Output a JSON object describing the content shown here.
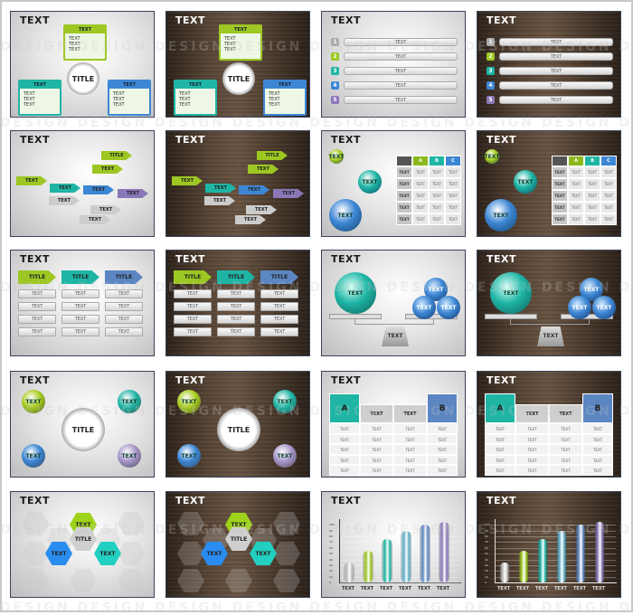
{
  "watermark": "DESIGN DESIGN DESIGN DESIGN DESIGN DESIGN DESIGN DESIGN DESIGN",
  "colors": {
    "green": "#9dc722",
    "teal": "#1fb5a5",
    "blue": "#3d86d4",
    "steel_blue": "#5b86c2",
    "purple": "#8a77b8",
    "grey": "#bdbdbd",
    "frame_border": "#3a4256"
  },
  "thumbnails": [
    {
      "id": 1,
      "theme": "light",
      "heading": "TEXT",
      "type": "three-box-hub",
      "center": "TITLE",
      "boxes": [
        {
          "label": "TEXT",
          "bullets": [
            "TEXT",
            "TEXT",
            "TEXT"
          ]
        },
        {
          "label": "TEXT",
          "bullets": [
            "TEXT",
            "TEXT",
            "TEXT"
          ]
        },
        {
          "label": "TEXT",
          "bullets": [
            "TEXT",
            "TEXT",
            "TEXT"
          ]
        }
      ]
    },
    {
      "id": 2,
      "theme": "dark",
      "heading": "TEXT",
      "type": "three-box-hub",
      "center": "TITLE",
      "boxes": [
        {
          "label": "TEXT",
          "bullets": [
            "TEXT",
            "TEXT",
            "TEXT"
          ]
        },
        {
          "label": "TEXT",
          "bullets": [
            "TEXT",
            "TEXT",
            "TEXT"
          ]
        },
        {
          "label": "TEXT",
          "bullets": [
            "TEXT",
            "TEXT",
            "TEXT"
          ]
        }
      ]
    },
    {
      "id": 3,
      "theme": "light",
      "heading": "TEXT",
      "type": "numbered-list",
      "items": [
        {
          "num": "1",
          "label": "TEXT"
        },
        {
          "num": "2",
          "label": "TEXT"
        },
        {
          "num": "3",
          "label": "TEXT"
        },
        {
          "num": "4",
          "label": "TEXT"
        },
        {
          "num": "5",
          "label": "TEXT"
        }
      ]
    },
    {
      "id": 4,
      "theme": "dark",
      "heading": "TEXT",
      "type": "numbered-list",
      "items": [
        {
          "num": "1",
          "label": "TEXT"
        },
        {
          "num": "2",
          "label": "TEXT"
        },
        {
          "num": "3",
          "label": "TEXT"
        },
        {
          "num": "4",
          "label": "TEXT"
        },
        {
          "num": "5",
          "label": "TEXT"
        }
      ]
    },
    {
      "id": 5,
      "theme": "light",
      "heading": "TEXT",
      "type": "org-tree",
      "nodes": [
        "TITLE",
        "TEXT",
        "TEXT",
        "TEXT",
        "TEXT",
        "TEXT",
        "TEXT",
        "TEXT",
        "TEXT"
      ]
    },
    {
      "id": 6,
      "theme": "dark",
      "heading": "TEXT",
      "type": "org-tree",
      "nodes": [
        "TITLE",
        "TEXT",
        "TEXT",
        "TEXT",
        "TEXT",
        "TEXT",
        "TEXT",
        "TEXT",
        "TEXT"
      ]
    },
    {
      "id": 7,
      "theme": "light",
      "heading": "TEXT",
      "type": "spheres-table",
      "spheres": [
        "TEXT",
        "TEXT",
        "TEXT"
      ],
      "table": {
        "columns": [
          "",
          "A",
          "B",
          "C"
        ],
        "rows": [
          [
            "TEXT",
            "TEXT",
            "TEXT",
            "TEXT"
          ],
          [
            "TEXT",
            "TEXT",
            "TEXT",
            "TEXT"
          ],
          [
            "TEXT",
            "TEXT",
            "TEXT",
            "TEXT"
          ],
          [
            "TEXT",
            "TEXT",
            "TEXT",
            "TEXT"
          ],
          [
            "TEXT",
            "TEXT",
            "TEXT",
            "TEXT"
          ]
        ]
      }
    },
    {
      "id": 8,
      "theme": "dark",
      "heading": "TEXT",
      "type": "spheres-table",
      "spheres": [
        "TEXT",
        "TEXT",
        "TEXT"
      ],
      "table": {
        "columns": [
          "",
          "A",
          "B",
          "C"
        ],
        "rows": [
          [
            "TEXT",
            "TEXT",
            "TEXT",
            "TEXT"
          ],
          [
            "TEXT",
            "TEXT",
            "TEXT",
            "TEXT"
          ],
          [
            "TEXT",
            "TEXT",
            "TEXT",
            "TEXT"
          ],
          [
            "TEXT",
            "TEXT",
            "TEXT",
            "TEXT"
          ],
          [
            "TEXT",
            "TEXT",
            "TEXT",
            "TEXT"
          ]
        ]
      }
    },
    {
      "id": 9,
      "theme": "light",
      "heading": "TEXT",
      "type": "three-columns",
      "columns": [
        {
          "title": "TITLE",
          "rows": [
            "TEXT",
            "TEXT",
            "TEXT",
            "TEXT"
          ]
        },
        {
          "title": "TITLE",
          "rows": [
            "TEXT",
            "TEXT",
            "TEXT",
            "TEXT"
          ]
        },
        {
          "title": "TITLE",
          "rows": [
            "TEXT",
            "TEXT",
            "TEXT",
            "TEXT"
          ]
        }
      ]
    },
    {
      "id": 10,
      "theme": "dark",
      "heading": "TEXT",
      "type": "three-columns",
      "columns": [
        {
          "title": "TITLE",
          "rows": [
            "TEXT",
            "TEXT",
            "TEXT",
            "TEXT"
          ]
        },
        {
          "title": "TITLE",
          "rows": [
            "TEXT",
            "TEXT",
            "TEXT",
            "TEXT"
          ]
        },
        {
          "title": "TITLE",
          "rows": [
            "TEXT",
            "TEXT",
            "TEXT",
            "TEXT"
          ]
        }
      ]
    },
    {
      "id": 11,
      "theme": "light",
      "heading": "TEXT",
      "type": "balance-scale",
      "left": "TEXT",
      "right": [
        "TEXT",
        "TEXT",
        "TEXT"
      ],
      "base": "TEXT"
    },
    {
      "id": 12,
      "theme": "dark",
      "heading": "TEXT",
      "type": "balance-scale",
      "left": "TEXT",
      "right": [
        "TEXT",
        "TEXT",
        "TEXT"
      ],
      "base": "TEXT"
    },
    {
      "id": 13,
      "theme": "light",
      "heading": "TEXT",
      "type": "four-spheres-hub",
      "center": "TITLE",
      "spheres": [
        "TEXT",
        "TEXT",
        "TEXT",
        "TEXT"
      ]
    },
    {
      "id": 14,
      "theme": "dark",
      "heading": "TEXT",
      "type": "four-spheres-hub",
      "center": "TITLE",
      "spheres": [
        "TEXT",
        "TEXT",
        "TEXT",
        "TEXT"
      ]
    },
    {
      "id": 15,
      "theme": "light",
      "heading": "TEXT",
      "type": "comparison-table",
      "headers": [
        "A",
        "TEXT",
        "TEXT",
        "B"
      ],
      "rows": [
        [
          "TEXT",
          "TEXT",
          "TEXT",
          "TEXT"
        ],
        [
          "TEXT",
          "TEXT",
          "TEXT",
          "TEXT"
        ],
        [
          "TEXT",
          "TEXT",
          "TEXT",
          "TEXT"
        ],
        [
          "TEXT",
          "TEXT",
          "TEXT",
          "TEXT"
        ],
        [
          "TEXT",
          "TEXT",
          "TEXT",
          "TEXT"
        ]
      ]
    },
    {
      "id": 16,
      "theme": "dark",
      "heading": "TEXT",
      "type": "comparison-table",
      "headers": [
        "A",
        "TEXT",
        "TEXT",
        "B"
      ],
      "rows": [
        [
          "TEXT",
          "TEXT",
          "TEXT",
          "TEXT"
        ],
        [
          "TEXT",
          "TEXT",
          "TEXT",
          "TEXT"
        ],
        [
          "TEXT",
          "TEXT",
          "TEXT",
          "TEXT"
        ],
        [
          "TEXT",
          "TEXT",
          "TEXT",
          "TEXT"
        ],
        [
          "TEXT",
          "TEXT",
          "TEXT",
          "TEXT"
        ]
      ]
    },
    {
      "id": 17,
      "theme": "light",
      "heading": "TEXT",
      "type": "hexagons",
      "center": "TITLE",
      "hexes": [
        "TEXT",
        "TEXT",
        "TEXT"
      ]
    },
    {
      "id": 18,
      "theme": "dark",
      "heading": "TEXT",
      "type": "hexagons",
      "center": "TITLE",
      "hexes": [
        "TEXT",
        "TEXT",
        "TEXT"
      ]
    },
    {
      "id": 19,
      "theme": "light",
      "heading": "TEXT",
      "type": "bar-chart"
    },
    {
      "id": 20,
      "theme": "dark",
      "heading": "TEXT",
      "type": "bar-chart"
    }
  ],
  "chart_data": {
    "type": "bar",
    "title": "TEXT",
    "categories": [
      "TEXT",
      "TEXT",
      "TEXT",
      "TEXT",
      "TEXT",
      "TEXT"
    ],
    "values": [
      35,
      55,
      75,
      90,
      100,
      105
    ],
    "bar_colors": [
      "#bdbdbd",
      "#9dc722",
      "#1fb5a5",
      "#5fb0c8",
      "#5b86c2",
      "#8a77b8"
    ],
    "yticks": [
      "0",
      "10",
      "20",
      "30",
      "40",
      "50",
      "60",
      "70",
      "80",
      "90",
      "100"
    ],
    "ylim": [
      0,
      110
    ],
    "xlabel": "",
    "ylabel": "",
    "grid": true
  }
}
